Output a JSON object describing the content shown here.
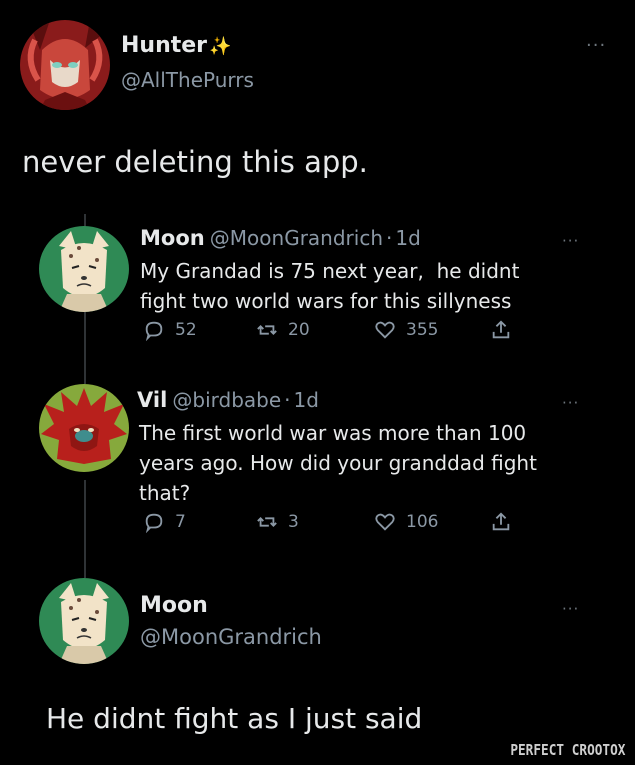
{
  "main_tweet": {
    "display_name": "Hunter",
    "sparkle": "✨",
    "handle": "@AllThePurrs",
    "text": "never deleting this app.",
    "more_glyph": "···"
  },
  "replies": [
    {
      "display_name": "Moon",
      "handle": "@MoonGrandrich",
      "separator": "·",
      "time": "1d",
      "more_glyph": "···",
      "text_lines": [
        "My Grandad is 75 next year,  he didnt",
        "fight two world wars for this sillyness"
      ],
      "reply_count": "52",
      "retweet_count": "20",
      "like_count": "355"
    },
    {
      "display_name": "Vil",
      "handle": "@birdbabe",
      "separator": "·",
      "time": "1d",
      "more_glyph": "···",
      "text_lines": [
        "The first world war was more than 100",
        "years ago. How did your granddad fight",
        "that?"
      ],
      "reply_count": "7",
      "retweet_count": "3",
      "like_count": "106"
    }
  ],
  "focus_tweet": {
    "display_name": "Moon",
    "handle": "@MoonGrandrich",
    "more_glyph": "···",
    "text": "He didnt fight as I just said"
  },
  "watermark": "PERFECT CROOTOX",
  "colors": {
    "background": "#000000",
    "text_primary": "#e7e9ea",
    "text_secondary": "#8b98a5",
    "thread_line": "#2f3336",
    "moon_avatar_bg": "#2f8a55",
    "vil_avatar_bg": "#86a93c",
    "hunter_avatar_bg": "#8a1b1b"
  },
  "icons": [
    "more-icon",
    "reply-icon",
    "retweet-icon",
    "like-icon",
    "share-icon",
    "sparkle-icon"
  ]
}
